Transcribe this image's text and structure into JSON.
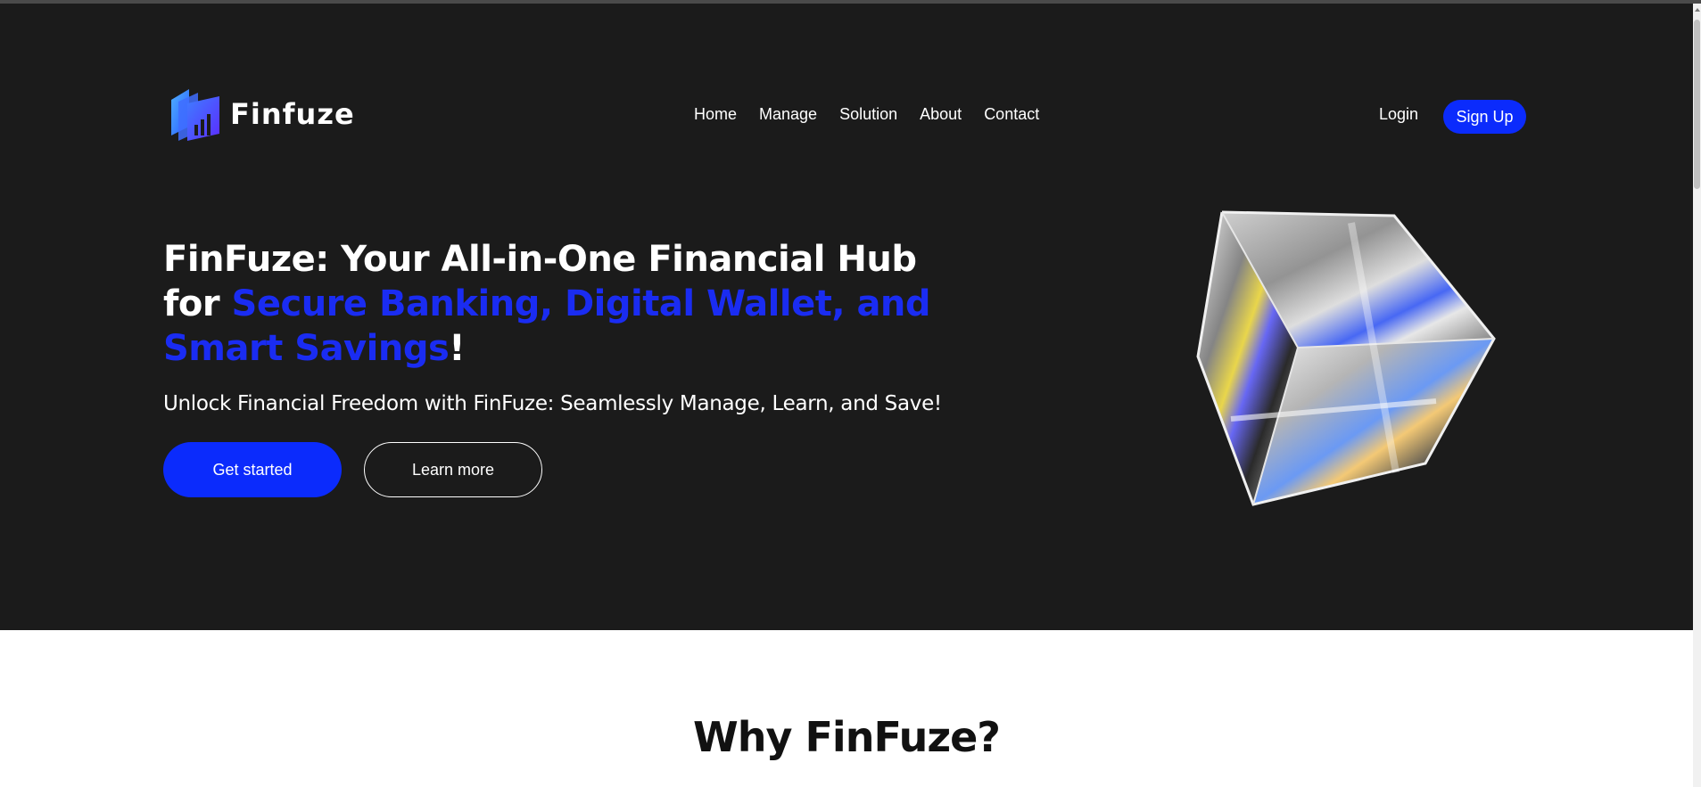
{
  "brand": {
    "name": "Finfuze"
  },
  "nav": {
    "links": [
      "Home",
      "Manage",
      "Solution",
      "About",
      "Contact"
    ],
    "login": "Login",
    "signup": "Sign Up"
  },
  "hero": {
    "headline_main": "FinFuze: Your All-in-One Financial Hub for ",
    "headline_accent": "Secure Banking, Digital Wallet, and Smart Savings",
    "headline_end": "!",
    "subtitle": "Unlock Financial Freedom with FinFuze: Seamlessly Manage, Learn, and Save!",
    "cta_primary": "Get started",
    "cta_secondary": "Learn more"
  },
  "section": {
    "title": "Why FinFuze?"
  },
  "colors": {
    "accent": "#0b2bfc",
    "hero_bg": "#1b1b1b",
    "accent_text": "#1a2cf2"
  },
  "icons": {
    "logo": "stacked-cards-chart-icon",
    "hero_image": "glass-cube"
  }
}
